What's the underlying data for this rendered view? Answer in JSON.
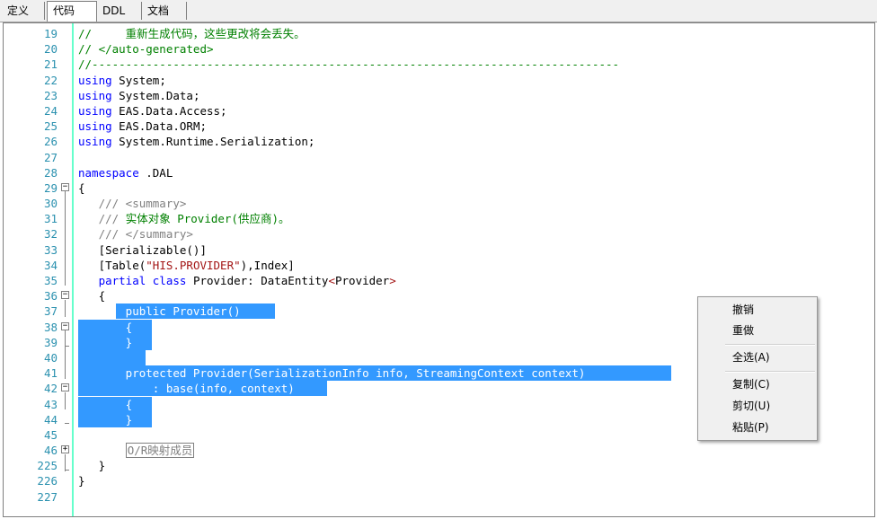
{
  "tabs": [
    {
      "label": "定义"
    },
    {
      "label": "代码"
    },
    {
      "label": "DDL"
    },
    {
      "label": "文档"
    }
  ],
  "editor": {
    "lines": [
      {
        "num": "19",
        "segs": [
          [
            "cm",
            "//     重新生成代码，这些更改将会丢失。"
          ]
        ]
      },
      {
        "num": "20",
        "segs": [
          [
            "cm",
            "// </auto-generated>"
          ]
        ]
      },
      {
        "num": "21",
        "segs": [
          [
            "cm",
            "//------------------------------------------------------------------------------"
          ]
        ]
      },
      {
        "num": "22",
        "segs": [
          [
            "kw",
            "using"
          ],
          [
            "tx",
            " System;"
          ]
        ]
      },
      {
        "num": "23",
        "segs": [
          [
            "kw",
            "using"
          ],
          [
            "tx",
            " System.Data;"
          ]
        ]
      },
      {
        "num": "24",
        "segs": [
          [
            "kw",
            "using"
          ],
          [
            "tx",
            " EAS.Data.Access;"
          ]
        ]
      },
      {
        "num": "25",
        "segs": [
          [
            "kw",
            "using"
          ],
          [
            "tx",
            " EAS.Data.ORM;"
          ]
        ]
      },
      {
        "num": "26",
        "segs": [
          [
            "kw",
            "using"
          ],
          [
            "tx",
            " System.Runtime.Serialization;"
          ]
        ]
      },
      {
        "num": "27",
        "segs": []
      },
      {
        "num": "28",
        "segs": [
          [
            "kw",
            "namespace"
          ],
          [
            "tx",
            " .DAL"
          ]
        ]
      },
      {
        "num": "29",
        "segs": [
          [
            "tx",
            "{"
          ]
        ]
      },
      {
        "num": "30",
        "segs": [
          [
            "tx",
            "   "
          ],
          [
            "doc",
            "/// <summary>"
          ]
        ]
      },
      {
        "num": "31",
        "segs": [
          [
            "tx",
            "   "
          ],
          [
            "doc",
            "/// "
          ],
          [
            "cm",
            "实体对象 Provider(供应商)。"
          ]
        ]
      },
      {
        "num": "32",
        "segs": [
          [
            "tx",
            "   "
          ],
          [
            "doc",
            "/// </summary>"
          ]
        ]
      },
      {
        "num": "33",
        "segs": [
          [
            "tx",
            "   [Serializable()]"
          ]
        ]
      },
      {
        "num": "34",
        "segs": [
          [
            "tx",
            "   [Table("
          ],
          [
            "str",
            "\"HIS.PROVIDER\""
          ],
          [
            "tx",
            "),Index]"
          ]
        ]
      },
      {
        "num": "35",
        "segs": [
          [
            "tx",
            "   "
          ],
          [
            "kw",
            "partial class"
          ],
          [
            "tx",
            " Provider: DataEntity"
          ],
          [
            "str",
            "<"
          ],
          [
            "tx",
            "Provider"
          ],
          [
            "str",
            ">"
          ]
        ]
      },
      {
        "num": "36",
        "segs": [
          [
            "tx",
            "   {"
          ]
        ]
      },
      {
        "num": "37",
        "segs": [
          [
            "wt",
            "       public Provider()"
          ]
        ]
      },
      {
        "num": "38",
        "segs": [
          [
            "wt",
            "       {"
          ]
        ]
      },
      {
        "num": "39",
        "segs": [
          [
            "wt",
            "       }"
          ]
        ]
      },
      {
        "num": "40",
        "segs": []
      },
      {
        "num": "41",
        "segs": [
          [
            "wt",
            "       protected Provider(SerializationInfo info, StreamingContext context)"
          ]
        ]
      },
      {
        "num": "42",
        "segs": [
          [
            "wt",
            "           : base(info, context)"
          ]
        ]
      },
      {
        "num": "43",
        "segs": [
          [
            "wt",
            "       {"
          ]
        ]
      },
      {
        "num": "44",
        "segs": [
          [
            "wt",
            "       }"
          ]
        ]
      },
      {
        "num": "45",
        "segs": []
      },
      {
        "num": "46",
        "segs": [
          [
            "tx",
            "       "
          ],
          [
            "collapsed",
            "O/R映射成员"
          ]
        ]
      },
      {
        "num": "225",
        "segs": [
          [
            "tx",
            "   }"
          ]
        ]
      },
      {
        "num": "226",
        "segs": [
          [
            "tx",
            "}"
          ]
        ]
      },
      {
        "num": "227",
        "segs": []
      }
    ]
  },
  "context_menu": {
    "items": [
      {
        "label": "撤销"
      },
      {
        "label": "重做"
      },
      {
        "label": "全选(A)"
      },
      {
        "label": "复制(C)"
      },
      {
        "label": "剪切(U)"
      },
      {
        "label": "粘贴(P)"
      }
    ]
  },
  "colors": {
    "keyword": "#0000ff",
    "comment": "#008000",
    "doc_comment": "#808080",
    "string": "#a31515",
    "line_number": "#2b91af",
    "selection": "#3399ff"
  }
}
